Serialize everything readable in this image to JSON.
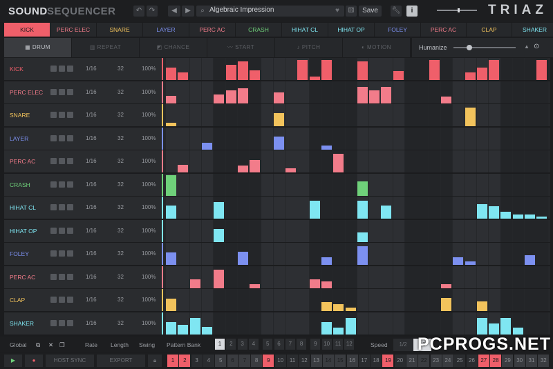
{
  "header": {
    "title_left": "SOUND",
    "title_right": "SEQUENCER",
    "preset_name": "Algebraic Impression",
    "save_label": "Save",
    "logo": "TRIAZ"
  },
  "tabs": [
    {
      "label": "KICK",
      "color": "#ef5f6a",
      "selected": true
    },
    {
      "label": "PERC ELEC",
      "color": "#f27c8a"
    },
    {
      "label": "SNARE",
      "color": "#f2c35c"
    },
    {
      "label": "LAYER",
      "color": "#7c90f0"
    },
    {
      "label": "PERC AC",
      "color": "#f27c8a"
    },
    {
      "label": "CRASH",
      "color": "#6fd17a"
    },
    {
      "label": "HIHAT CL",
      "color": "#7fe6f2"
    },
    {
      "label": "HIHAT OP",
      "color": "#7fe6f2"
    },
    {
      "label": "FOLEY",
      "color": "#7c90f0"
    },
    {
      "label": "PERC AC",
      "color": "#f27c8a"
    },
    {
      "label": "CLAP",
      "color": "#f2c35c"
    },
    {
      "label": "SHAKER",
      "color": "#7fe6f2"
    }
  ],
  "modes": [
    {
      "label": "DRUM",
      "selected": true
    },
    {
      "label": "REPEAT"
    },
    {
      "label": "CHANCE"
    },
    {
      "label": "START"
    },
    {
      "label": "PITCH"
    },
    {
      "label": "MOTION"
    }
  ],
  "humanize_label": "Humanize",
  "humanize_value": 0.26,
  "rows": [
    {
      "name": "KICK",
      "color": "#ef5f6a",
      "rate": "1/16",
      "length": "32",
      "swing": "100%",
      "steps": [
        0,
        0.55,
        0.35,
        0,
        0,
        0,
        0,
        0,
        0,
        0,
        0,
        0,
        0,
        0,
        0,
        0,
        0,
        0,
        0,
        0,
        0,
        0,
        0,
        0,
        0,
        0,
        0,
        0,
        0,
        0,
        0,
        0
      ]
    },
    {
      "name": "PERC ELEC",
      "color": "#f27c8a",
      "rate": "1/16",
      "length": "32",
      "swing": "100%",
      "steps": [
        0,
        0.35,
        0,
        0,
        0,
        0,
        0,
        0,
        0,
        0,
        0,
        0,
        0,
        0,
        0,
        0,
        0,
        0,
        0,
        0,
        0,
        0,
        0,
        0,
        0,
        0,
        0,
        0,
        0,
        0,
        0,
        0
      ]
    },
    {
      "name": "SNARE",
      "color": "#f2c35c",
      "rate": "1/16",
      "length": "32",
      "swing": "100%",
      "steps": [
        0,
        0.18,
        0,
        0,
        0,
        0,
        0,
        0,
        0,
        0,
        0,
        0,
        0,
        0,
        0,
        0,
        0,
        0,
        0,
        0,
        0,
        0,
        0,
        0,
        0,
        0,
        0,
        0,
        0,
        0,
        0,
        0
      ]
    },
    {
      "name": "LAYER",
      "color": "#7c90f0",
      "rate": "1/16",
      "length": "32",
      "swing": "100%",
      "steps": [
        0,
        0,
        0,
        0,
        0.3,
        0,
        0,
        0,
        0,
        0,
        0,
        0,
        0,
        0,
        0,
        0,
        0,
        0,
        0,
        0,
        0,
        0,
        0,
        0,
        0,
        0,
        0,
        0,
        0,
        0,
        0,
        0
      ]
    },
    {
      "name": "PERC AC",
      "color": "#f27c8a",
      "rate": "1/16",
      "length": "32",
      "swing": "100%",
      "steps": [
        0,
        0,
        0.35,
        0,
        0,
        0,
        0,
        0,
        0,
        0,
        0,
        0,
        0,
        0,
        0,
        0,
        0,
        0,
        0,
        0,
        0,
        0,
        0,
        0,
        0,
        0,
        0,
        0,
        0,
        0,
        0,
        0
      ]
    },
    {
      "name": "CRASH",
      "color": "#6fd17a",
      "rate": "1/16",
      "length": "32",
      "swing": "100%",
      "steps": [
        0,
        0.95,
        0,
        0,
        0,
        0,
        0,
        0,
        0,
        0,
        0,
        0,
        0,
        0,
        0,
        0,
        0,
        0,
        0,
        0,
        0,
        0,
        0,
        0,
        0,
        0,
        0,
        0,
        0,
        0,
        0,
        0
      ]
    },
    {
      "name": "HIHAT CL",
      "color": "#7fe6f2",
      "rate": "1/16",
      "length": "32",
      "swing": "100%",
      "steps": [
        0,
        0.6,
        0,
        0,
        0,
        0,
        0,
        0,
        0,
        0,
        0,
        0,
        0,
        0,
        0,
        0,
        0,
        0,
        0,
        0,
        0,
        0,
        0,
        0,
        0,
        0,
        0,
        0,
        0,
        0,
        0,
        0
      ]
    },
    {
      "name": "HIHAT OP",
      "color": "#7fe6f2",
      "rate": "1/16",
      "length": "32",
      "swing": "100%",
      "steps": [
        0,
        0,
        0,
        0,
        0,
        0,
        0,
        0,
        0,
        0,
        0,
        0,
        0,
        0,
        0,
        0,
        0,
        0,
        0,
        0,
        0,
        0,
        0,
        0,
        0,
        0,
        0,
        0,
        0,
        0,
        0,
        0
      ]
    },
    {
      "name": "FOLEY",
      "color": "#7c90f0",
      "rate": "1/16",
      "length": "32",
      "swing": "100%",
      "steps": [
        0,
        0.55,
        0,
        0,
        0,
        0,
        0,
        0,
        0,
        0,
        0,
        0,
        0,
        0,
        0,
        0,
        0,
        0,
        0,
        0,
        0,
        0,
        0,
        0,
        0,
        0,
        0,
        0,
        0,
        0,
        0,
        0
      ]
    },
    {
      "name": "PERC AC",
      "color": "#f27c8a",
      "rate": "1/16",
      "length": "32",
      "swing": "100%",
      "steps": [
        0,
        0,
        0,
        0.42,
        0,
        0,
        0,
        0,
        0,
        0,
        0,
        0,
        0,
        0,
        0,
        0,
        0,
        0,
        0,
        0,
        0,
        0,
        0,
        0,
        0,
        0,
        0,
        0,
        0,
        0,
        0,
        0
      ]
    },
    {
      "name": "CLAP",
      "color": "#f2c35c",
      "rate": "1/16",
      "length": "32",
      "swing": "100%",
      "steps": [
        0,
        0.55,
        0,
        0,
        0,
        0,
        0,
        0,
        0,
        0,
        0,
        0,
        0,
        0,
        0,
        0,
        0,
        0,
        0,
        0,
        0,
        0,
        0,
        0,
        0,
        0,
        0,
        0,
        0,
        0,
        0,
        0
      ]
    },
    {
      "name": "SHAKER",
      "color": "#7fe6f2",
      "rate": "1/16",
      "length": "32",
      "swing": "100%",
      "steps": [
        0,
        0.55,
        0.45,
        0.75,
        0.35,
        0,
        0,
        0,
        0,
        0,
        0,
        0,
        0,
        0,
        0,
        0,
        0,
        0,
        0,
        0,
        0,
        0,
        0,
        0,
        0,
        0,
        0,
        0,
        0,
        0,
        0,
        0
      ]
    }
  ],
  "bottom": {
    "global_label": "Global",
    "rate_label": "Rate",
    "length_label": "Length",
    "swing_label": "Swing",
    "pattern_bank_label": "Pattern Bank",
    "patterns": [
      "1",
      "2",
      "3",
      "4",
      "5",
      "6",
      "7",
      "8",
      "9",
      "10",
      "11",
      "12"
    ],
    "speed_label": "Speed",
    "speed_options": [
      "1/2",
      "×1"
    ],
    "host_sync": "HOST SYNC",
    "export": "EXPORT",
    "steps": [
      "1",
      "2",
      "3",
      "4",
      "5",
      "6",
      "7",
      "8",
      "9",
      "10",
      "11",
      "12",
      "13",
      "14",
      "15",
      "16",
      "17",
      "18",
      "19",
      "20",
      "21",
      "22",
      "23",
      "24",
      "25",
      "26",
      "27",
      "28",
      "29",
      "30",
      "31",
      "32"
    ],
    "active_steps": [
      "1",
      "2",
      "6",
      "7",
      "9",
      "14",
      "15",
      "19",
      "22",
      "27",
      "28"
    ]
  },
  "watermark": "PCPROGS.NET"
}
